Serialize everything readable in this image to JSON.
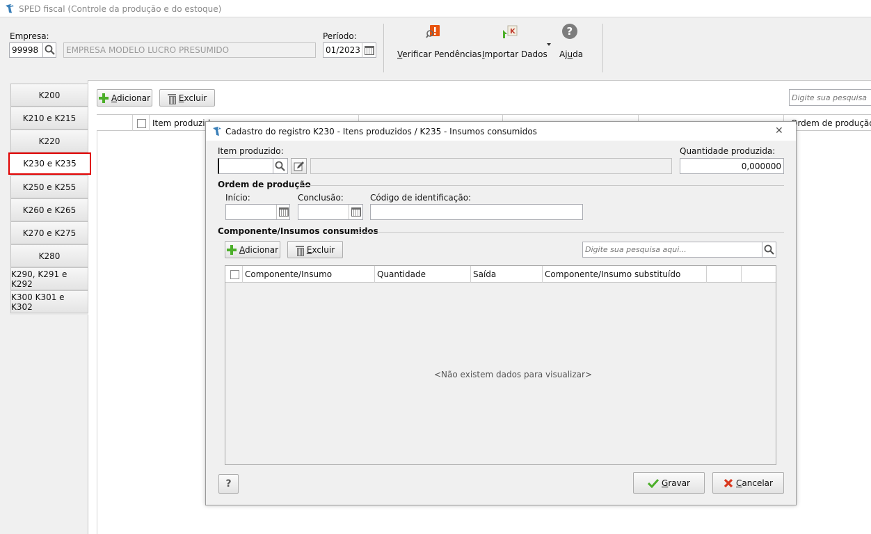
{
  "window": {
    "title": "SPED fiscal (Controle da produção e do estoque)"
  },
  "header": {
    "empresa_label": "Empresa:",
    "empresa_code": "99998",
    "empresa_name": "EMPRESA MODELO LUCRO PRESUMIDO",
    "periodo_label": "Período:",
    "periodo_value": "01/2023"
  },
  "toolbar": {
    "verificar_prefix": "V",
    "verificar_rest": "erificar Pendências",
    "importar_prefix": "I",
    "importar_rest": "mportar Dados",
    "ajuda_pre": "Aj",
    "ajuda_u": "u",
    "ajuda_post": "da"
  },
  "tabs": [
    "K200",
    "K210 e K215",
    "K220",
    "K230 e K235",
    "K250 e K255",
    "K260 e K265",
    "K270 e K275",
    "K280",
    "K290, K291 e K292",
    "K300 K301 e K302"
  ],
  "main": {
    "add_u": "A",
    "add_rest": "dicionar",
    "delete_u": "E",
    "delete_rest": "xcluir",
    "search_placeholder": "Digite sua pesquisa aqui...",
    "col_item": "Item produzido",
    "col_ordem": "Ordem de produção"
  },
  "dialog": {
    "title": "Cadastro do registro K230 - Itens produzidos / K235 - Insumos consumidos",
    "item_label": "Item produzido:",
    "item_code": "",
    "qty_label": "Quantidade produzida:",
    "qty_value": "0,000000",
    "ordem_section": "Ordem de produção",
    "inicio_label": "Início:",
    "conclusao_label": "Conclusão:",
    "codigo_label": "Código de identificação:",
    "insumos_section": "Componente/Insumos consumidos",
    "add_u": "A",
    "add_rest": "dicionar",
    "delete_u": "E",
    "delete_rest": "xcluir",
    "search_placeholder": "Digite sua pesquisa aqui...",
    "columns": [
      "Componente/Insumo",
      "Quantidade",
      "Saída",
      "Componente/Insumo substituído"
    ],
    "empty_text": "<Não existem dados para visualizar>",
    "help_label": "?",
    "save_u": "G",
    "save_rest": "ravar",
    "cancel_u": "C",
    "cancel_rest": "ancelar"
  },
  "colors": {
    "highlight": "#e00000",
    "accent_green": "#4caf2a",
    "cancel_red": "#d9381e"
  }
}
